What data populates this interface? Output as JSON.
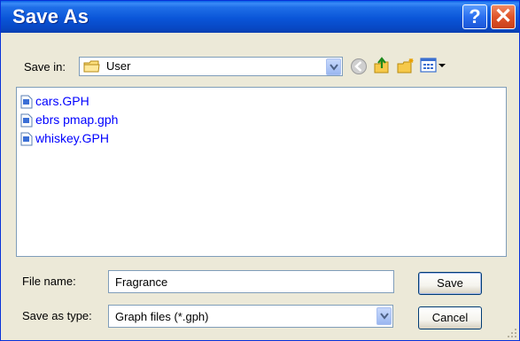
{
  "window": {
    "title": "Save As"
  },
  "titlebar": {
    "help_label": "?",
    "close_label": "✕"
  },
  "save_in": {
    "label": "Save in:",
    "value": "User"
  },
  "files": [
    {
      "name": "cars.GPH"
    },
    {
      "name": "ebrs pmap.gph"
    },
    {
      "name": "whiskey.GPH"
    }
  ],
  "file_name": {
    "label": "File name:",
    "value": "Fragrance"
  },
  "save_as_type": {
    "label": "Save as type:",
    "value": "Graph files (*.gph)"
  },
  "buttons": {
    "save": "Save",
    "cancel": "Cancel"
  },
  "colors": {
    "title_bar": "#0a55d8",
    "file_text": "#0000ff",
    "dialog_bg": "#ece9d8"
  },
  "icons": {
    "save_in_folder": "folder-icon",
    "back": "back-arrow-icon",
    "up": "up-folder-icon",
    "new_folder": "new-folder-icon",
    "views": "views-menu-icon",
    "file": "file-icon"
  }
}
